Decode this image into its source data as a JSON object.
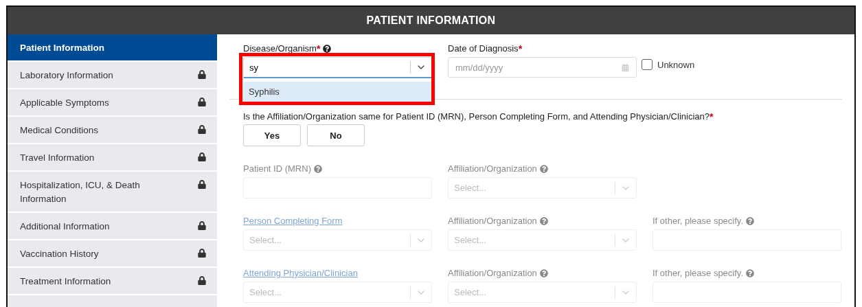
{
  "header": {
    "title": "PATIENT INFORMATION"
  },
  "sidebar": {
    "items": [
      {
        "label": "Patient Information",
        "selected": true,
        "locked": false
      },
      {
        "label": "Laboratory Information",
        "selected": false,
        "locked": true
      },
      {
        "label": "Applicable Symptoms",
        "selected": false,
        "locked": true
      },
      {
        "label": "Medical Conditions",
        "selected": false,
        "locked": true
      },
      {
        "label": "Travel Information",
        "selected": false,
        "locked": true
      },
      {
        "label": "Hospitalization, ICU, & Death Information",
        "selected": false,
        "locked": true
      },
      {
        "label": "Additional Information",
        "selected": false,
        "locked": true
      },
      {
        "label": "Vaccination History",
        "selected": false,
        "locked": true
      },
      {
        "label": "Treatment Information",
        "selected": false,
        "locked": true
      }
    ]
  },
  "disease": {
    "label": "Disease/Organism",
    "required_mark": "*",
    "help": true,
    "value": "sy",
    "highlighted": true,
    "options": [
      {
        "label": "Syphilis",
        "selected": true
      }
    ]
  },
  "diagnosis_date": {
    "label": "Date of Diagnosis",
    "required_mark": "*",
    "placeholder": "mm/dd/yyyy"
  },
  "unknown": {
    "label": "Unknown",
    "checked": false
  },
  "question": {
    "text": "Is the Affiliation/Organization same for Patient ID (MRN), Person Completing Form, and Attending Physician/Clinician?",
    "required_mark": "*",
    "buttons": [
      {
        "label": "Yes",
        "selected": false
      },
      {
        "label": "No",
        "selected": false
      }
    ]
  },
  "field_rows": [
    {
      "fields": [
        {
          "kind": "text",
          "label": "Patient ID (MRN)",
          "link": false,
          "help": true,
          "disabled": true
        },
        {
          "kind": "select",
          "label": "Affiliation/Organization",
          "link": false,
          "help": true,
          "disabled": true,
          "placeholder": "Select..."
        }
      ]
    },
    {
      "fields": [
        {
          "kind": "select",
          "label": "Person Completing Form",
          "link": true,
          "help": false,
          "disabled": true,
          "placeholder": "Select..."
        },
        {
          "kind": "select",
          "label": "Affiliation/Organization",
          "link": false,
          "help": true,
          "disabled": true,
          "placeholder": "Select..."
        },
        {
          "kind": "text",
          "label": "If other, please specify.",
          "link": false,
          "help": true,
          "disabled": true
        }
      ]
    },
    {
      "fields": [
        {
          "kind": "select",
          "label": "Attending Physician/Clinician",
          "link": true,
          "help": false,
          "disabled": true,
          "placeholder": "Select..."
        },
        {
          "kind": "select",
          "label": "Affiliation/Organization",
          "link": false,
          "help": true,
          "disabled": true,
          "placeholder": "Select..."
        },
        {
          "kind": "text",
          "label": "If other, please specify.",
          "link": false,
          "help": true,
          "disabled": true
        }
      ]
    }
  ]
}
